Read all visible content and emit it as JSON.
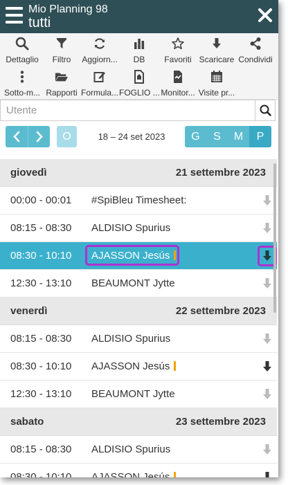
{
  "header": {
    "title": "Mio Planning 98",
    "subtitle": "tutti"
  },
  "toolbar": {
    "row1": [
      {
        "label": "Dettaglio",
        "icon": "search-icon"
      },
      {
        "label": "Filtro",
        "icon": "filter-icon"
      },
      {
        "label": "Aggiorn...",
        "icon": "refresh-icon"
      },
      {
        "label": "DB",
        "icon": "bar-chart-icon"
      },
      {
        "label": "Favoriti",
        "icon": "star-icon"
      },
      {
        "label": "Scaricare",
        "icon": "download-icon"
      },
      {
        "label": "Condividi",
        "icon": "share-icon"
      }
    ],
    "row2": [
      {
        "label": "Sotto-m...",
        "icon": "more-vertical-icon"
      },
      {
        "label": "Rapporti",
        "icon": "folder-open-icon"
      },
      {
        "label": "Formula...",
        "icon": "edit-icon"
      },
      {
        "label": "FOGLIO ...",
        "icon": "document-icon"
      },
      {
        "label": "Monitor...",
        "icon": "monitor-doc-icon"
      },
      {
        "label": "Visite pr...",
        "icon": "calendar-icon"
      }
    ]
  },
  "search": {
    "placeholder": "Utente",
    "value": ""
  },
  "nav": {
    "prev": "‹",
    "next": "›",
    "o_label": "O",
    "date_range": "18 – 24 set 2023",
    "views": [
      "G",
      "S",
      "M",
      "P"
    ],
    "active_view": "P"
  },
  "days": [
    {
      "name": "giovedì",
      "date": "21 settembre 2023",
      "entries": [
        {
          "time": "00:00 - 00:01",
          "who": "#SpiBleu Timesheet:",
          "mark": false,
          "selected": false,
          "dark": false
        },
        {
          "time": "08:15 - 08:30",
          "who": "ALDISIO Spurius",
          "mark": false,
          "selected": false,
          "dark": false
        },
        {
          "time": "08:30 - 10:10",
          "who": "AJASSON Jesús",
          "mark": true,
          "selected": true,
          "dark": true
        },
        {
          "time": "12:30 - 13:10",
          "who": "BEAUMONT Jytte",
          "mark": false,
          "selected": false,
          "dark": false
        }
      ]
    },
    {
      "name": "venerdì",
      "date": "22 settembre 2023",
      "entries": [
        {
          "time": "08:15 - 08:30",
          "who": "ALDISIO Spurius",
          "mark": false,
          "selected": false,
          "dark": false
        },
        {
          "time": "08:30 - 10:10",
          "who": "AJASSON Jesús",
          "mark": true,
          "selected": false,
          "dark": true
        },
        {
          "time": "12:30 - 13:10",
          "who": "BEAUMONT Jytte",
          "mark": false,
          "selected": false,
          "dark": false
        }
      ]
    },
    {
      "name": "sabato",
      "date": "23 settembre 2023",
      "entries": [
        {
          "time": "08:15 - 08:30",
          "who": "ALDISIO Spurius",
          "mark": false,
          "selected": false,
          "dark": false
        },
        {
          "time": "08:30 - 10:10",
          "who": "AJASSON Jesús",
          "mark": true,
          "selected": false,
          "dark": true
        }
      ]
    }
  ],
  "colors": {
    "header_bg": "#2f4f56",
    "accent": "#5bbcd0",
    "accent_light": "#a8dce8",
    "selected_row": "#3bb0cc",
    "highlight_box": "#b030d0",
    "mark": "#f0a500"
  }
}
